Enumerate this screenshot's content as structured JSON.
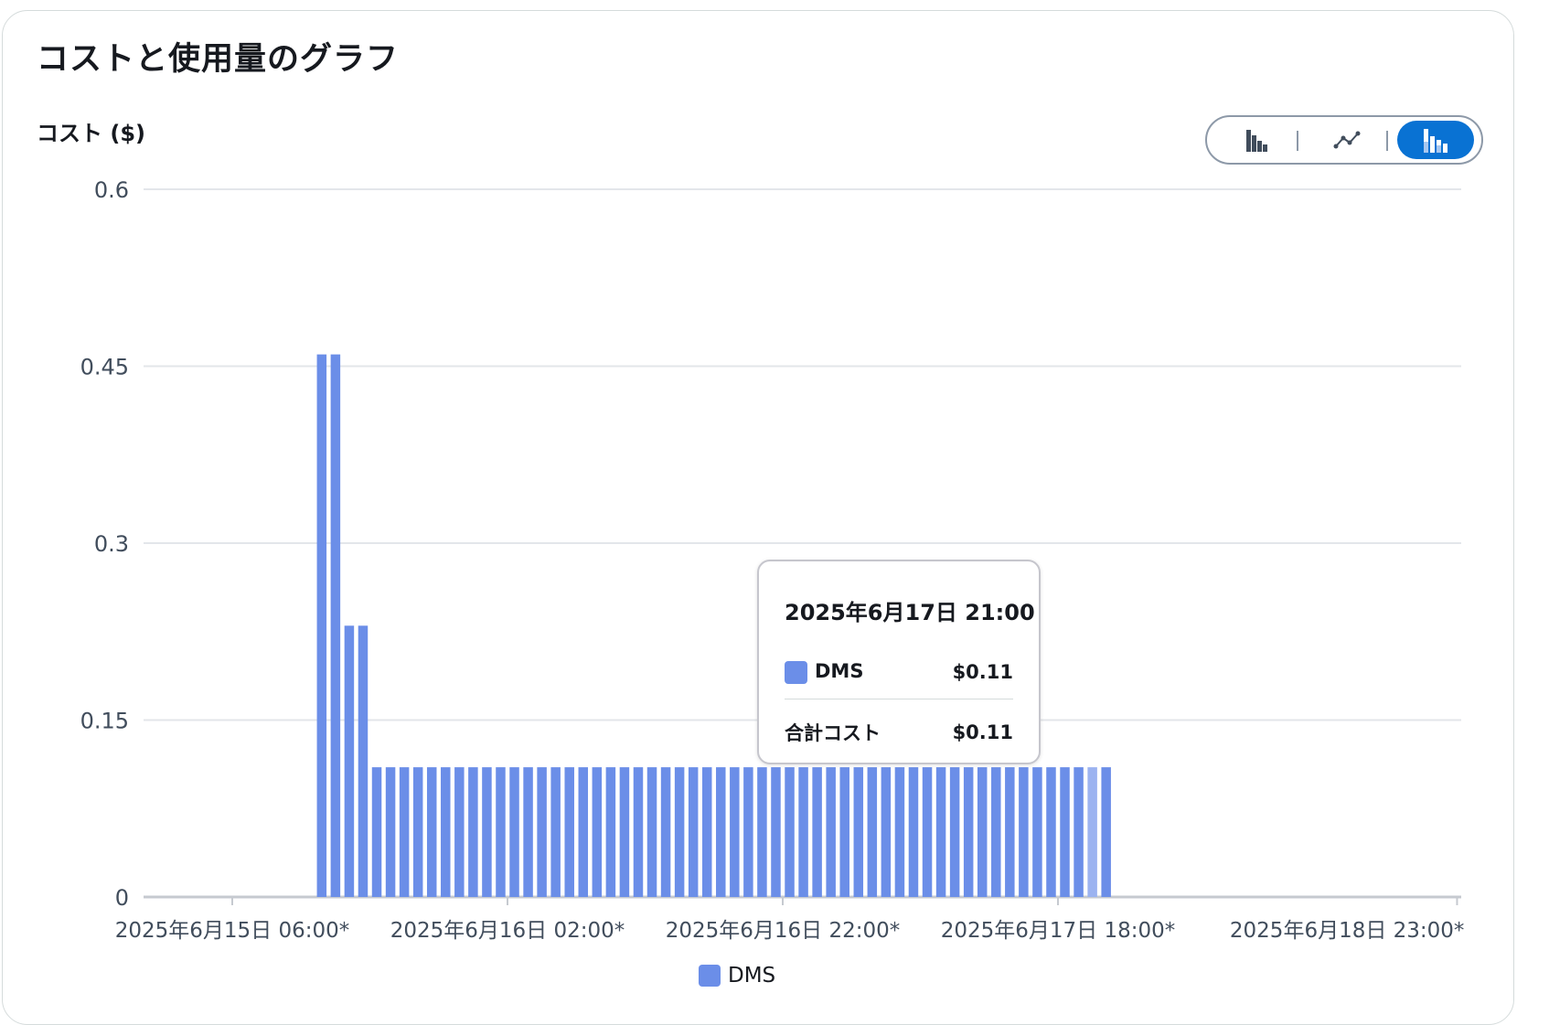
{
  "panel": {
    "title": "コストと使用量のグラフ"
  },
  "view_toggle": {
    "options": [
      {
        "name": "bar-chart-icon",
        "active": false
      },
      {
        "name": "line-chart-icon",
        "active": false
      },
      {
        "name": "stacked-bar-chart-icon",
        "active": true
      }
    ]
  },
  "colors": {
    "series": "#6b8ee8",
    "series_highlight": "#9cb3f0",
    "grid": "#e3e6ea",
    "axis": "#c6cad0",
    "active_toggle": "#0972d3"
  },
  "chart_data": {
    "type": "bar",
    "title": "コストと使用量のグラフ",
    "ylabel": "コスト ($)",
    "xlabel": "",
    "ylim": [
      0,
      0.6
    ],
    "yticks": [
      "0",
      "0.15",
      "0.3",
      "0.45",
      "0.6"
    ],
    "x_tick_labels": [
      "2025年6月15日 06:00*",
      "2025年6月16日 02:00*",
      "2025年6月16日 22:00*",
      "2025年6月17日 18:00*",
      "2025年6月18日 23:00*"
    ],
    "x_tick_label_hours": [
      0,
      20,
      40,
      60,
      89
    ],
    "bar_start_hour": 6,
    "series": [
      {
        "name": "DMS",
        "values": [
          0.46,
          0.46,
          0.23,
          0.23,
          0.11,
          0.11,
          0.11,
          0.11,
          0.11,
          0.11,
          0.11,
          0.11,
          0.11,
          0.11,
          0.11,
          0.11,
          0.11,
          0.11,
          0.11,
          0.11,
          0.11,
          0.11,
          0.11,
          0.11,
          0.11,
          0.11,
          0.11,
          0.11,
          0.11,
          0.11,
          0.11,
          0.11,
          0.11,
          0.11,
          0.11,
          0.11,
          0.11,
          0.11,
          0.11,
          0.11,
          0.11,
          0.11,
          0.11,
          0.11,
          0.11,
          0.11,
          0.11,
          0.11,
          0.11,
          0.11,
          0.11,
          0.11,
          0.11,
          0.11,
          0.11,
          0.11,
          0.11,
          0.11
        ]
      }
    ],
    "highlighted_index": 56,
    "legend_position": "bottom",
    "grid": true
  },
  "tooltip": {
    "title": "2025年6月17日 21:00",
    "series_name": "DMS",
    "series_value": "$0.11",
    "total_label": "合計コスト",
    "total_value": "$0.11"
  },
  "legend": {
    "items": [
      {
        "label": "DMS"
      }
    ]
  }
}
